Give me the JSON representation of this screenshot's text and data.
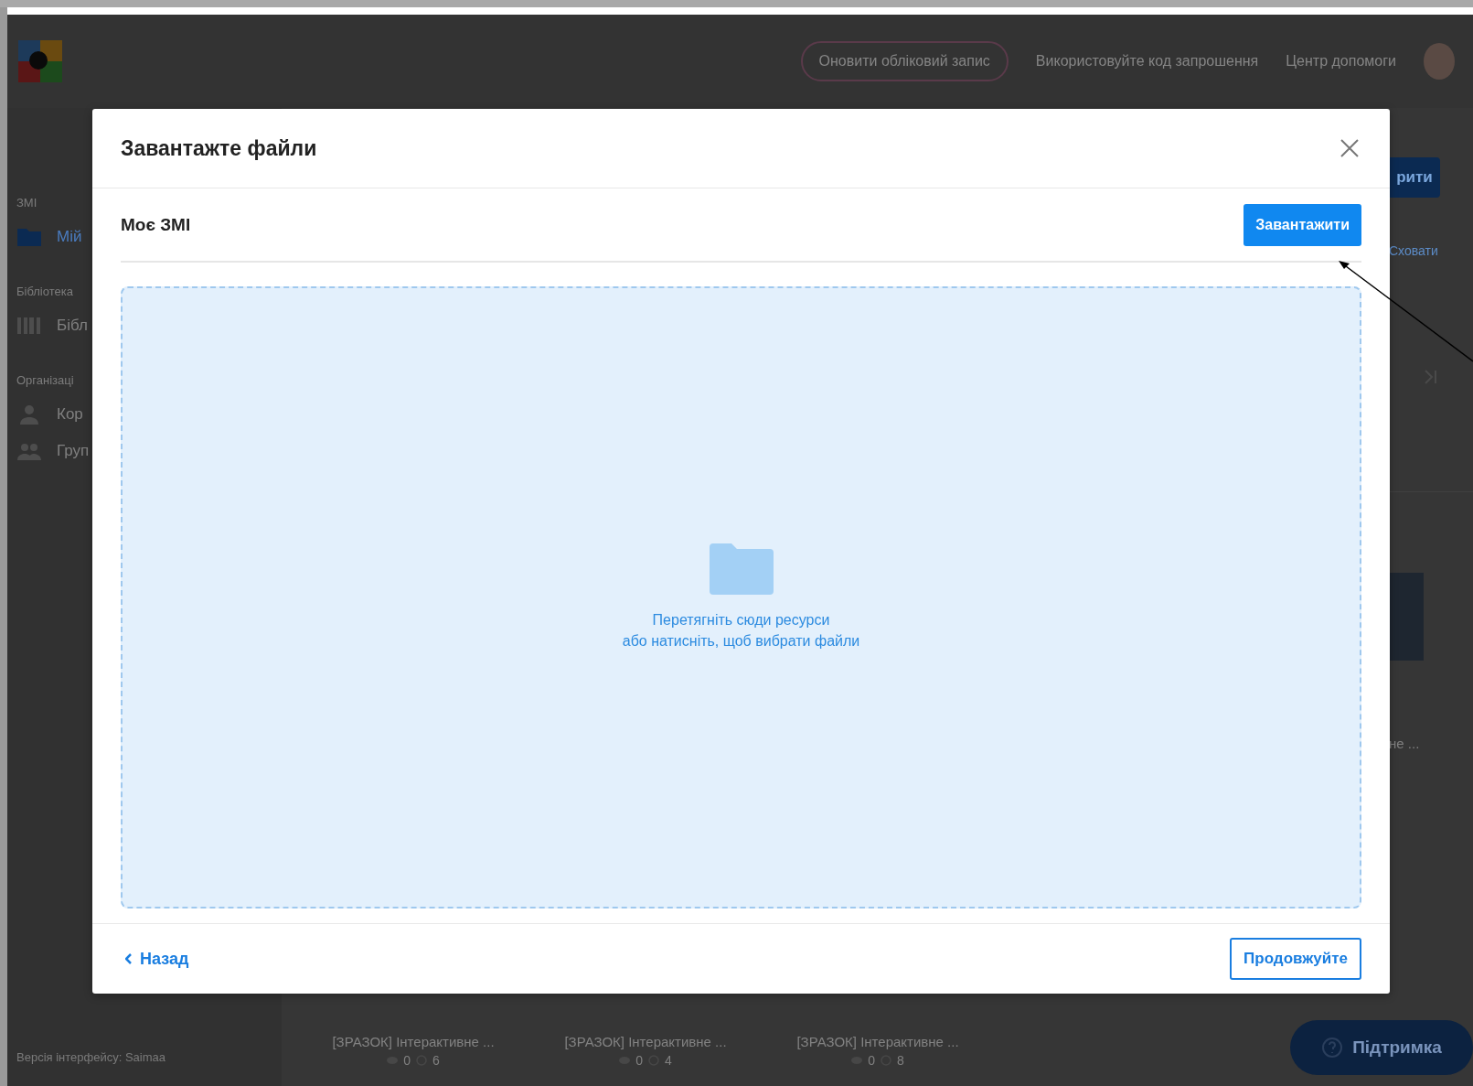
{
  "app": {
    "header": {
      "upgrade_button": "Оновити обліковий запис",
      "links": [
        "Використовуйте код запрошення",
        "Центр допомоги"
      ]
    },
    "sidebar": {
      "sections": [
        {
          "heading": "ЗМІ",
          "items": [
            {
              "label": "Мій",
              "kind": "folder"
            }
          ]
        },
        {
          "heading": "Бібліотека",
          "items": [
            {
              "label": "Бібл",
              "kind": "library"
            }
          ]
        },
        {
          "heading": "Організаці",
          "items": [
            {
              "label": "Кор",
              "kind": "user"
            },
            {
              "label": "Груп",
              "kind": "group"
            }
          ]
        }
      ],
      "version": "Версія інтерфейсу: Saimaa"
    },
    "main": {
      "action_button": "рити",
      "hide_link": "Сховати",
      "card_title": "не ...",
      "cards": [
        {
          "title": "[ЗРАЗОК] Інтерактивне ...",
          "views": "0",
          "duration": "6"
        },
        {
          "title": "[ЗРАЗОК] Інтерактивне ...",
          "views": "0",
          "duration": "4"
        },
        {
          "title": "[ЗРАЗОК] Інтерактивне ...",
          "views": "0",
          "duration": "8"
        }
      ]
    },
    "support_button": "Підтримка"
  },
  "dialog": {
    "title": "Завантажте файли",
    "breadcrumb": "Моє ЗМІ",
    "upload_button": "Завантажити",
    "dropzone": {
      "lines": [
        "Перетягніть сюди ресурси",
        "або натисніть, щоб вибрати файли"
      ]
    },
    "back_button": "Назад",
    "continue_button": "Продовжуйте"
  }
}
